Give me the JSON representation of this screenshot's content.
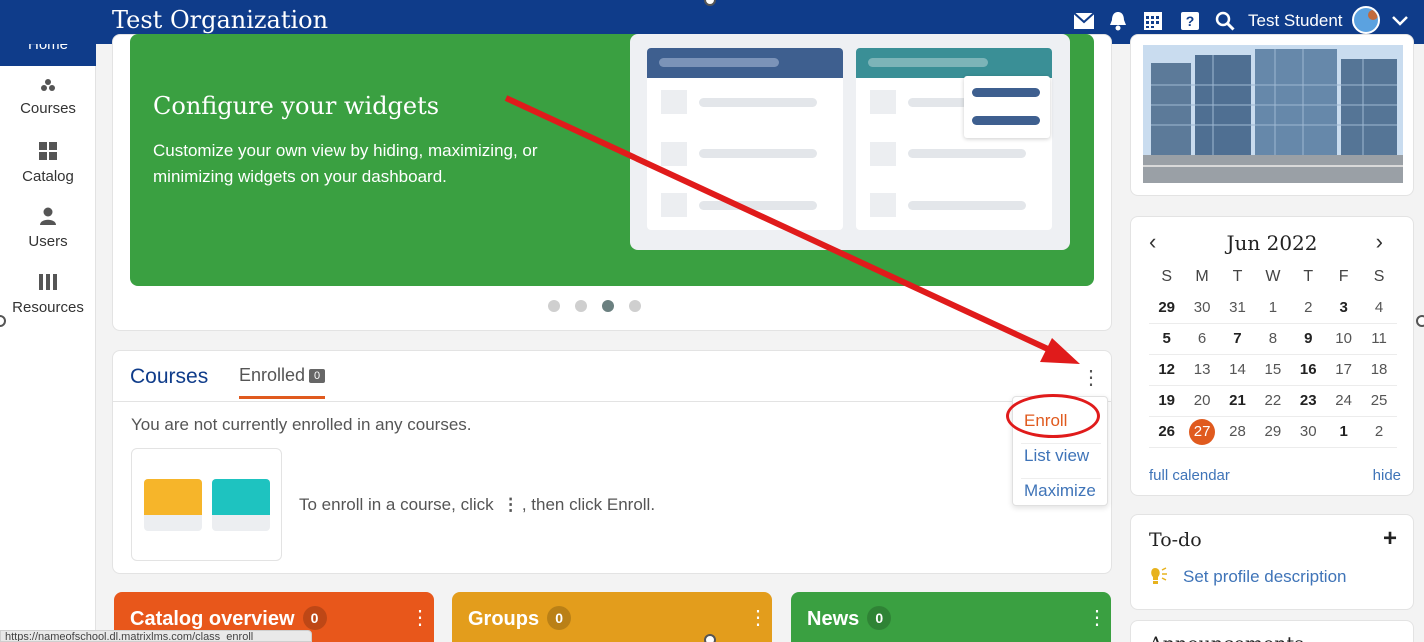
{
  "header": {
    "org_title": "Test Organization",
    "user_name": "Test Student",
    "icons": [
      "mail-icon",
      "bell-icon",
      "calendar-grid-icon",
      "help-icon",
      "search-icon",
      "chevron-down-icon"
    ]
  },
  "sidebar": {
    "items": [
      {
        "label": "Home",
        "icon": "home-icon"
      },
      {
        "label": "Courses",
        "icon": "courses-icon"
      },
      {
        "label": "Catalog",
        "icon": "grid-icon"
      },
      {
        "label": "Users",
        "icon": "user-icon"
      },
      {
        "label": "Resources",
        "icon": "books-icon"
      }
    ]
  },
  "banner": {
    "title": "Configure your widgets",
    "text": "Customize your own view by hiding, maximizing, or minimizing widgets on your dashboard.",
    "slide_count": 4,
    "active_slide": 3
  },
  "courses_widget": {
    "tab_courses": "Courses",
    "tab_enrolled": "Enrolled",
    "enrolled_count": "0",
    "empty_message": "You are not currently enrolled in any courses.",
    "hint_before": "To enroll in a course, click",
    "hint_after": ", then click Enroll.",
    "menu": {
      "enroll": "Enroll",
      "list_view": "List view",
      "maximize": "Maximize"
    }
  },
  "bottom_widgets": [
    {
      "title": "Catalog overview",
      "count": "0",
      "color": "#e8571b"
    },
    {
      "title": "Groups",
      "count": "0",
      "color": "#e39d1c"
    },
    {
      "title": "News",
      "count": "0",
      "color": "#3aa041"
    }
  ],
  "calendar": {
    "month_label": "Jun 2022",
    "weekdays": [
      "S",
      "M",
      "T",
      "W",
      "T",
      "F",
      "S"
    ],
    "weeks": [
      [
        "29",
        "30",
        "31",
        "1",
        "2",
        "3",
        "4"
      ],
      [
        "5",
        "6",
        "7",
        "8",
        "9",
        "10",
        "11"
      ],
      [
        "12",
        "13",
        "14",
        "15",
        "16",
        "17",
        "18"
      ],
      [
        "19",
        "20",
        "21",
        "22",
        "23",
        "24",
        "25"
      ],
      [
        "26",
        "27",
        "28",
        "29",
        "30",
        "1",
        "2"
      ]
    ],
    "today": "27",
    "full_calendar": "full calendar",
    "hide": "hide"
  },
  "todo": {
    "title": "To-do",
    "item": "Set profile description"
  },
  "announcements": {
    "title": "Announcements"
  },
  "status_url": "https://nameofschool.dl.matrixlms.com/class_enroll",
  "colors": {
    "header": "#0f3c8a",
    "accent_orange": "#e05a1e",
    "banner_green": "#3aa041",
    "link_blue": "#3f74b8",
    "annotation_red": "#e01b1b"
  }
}
